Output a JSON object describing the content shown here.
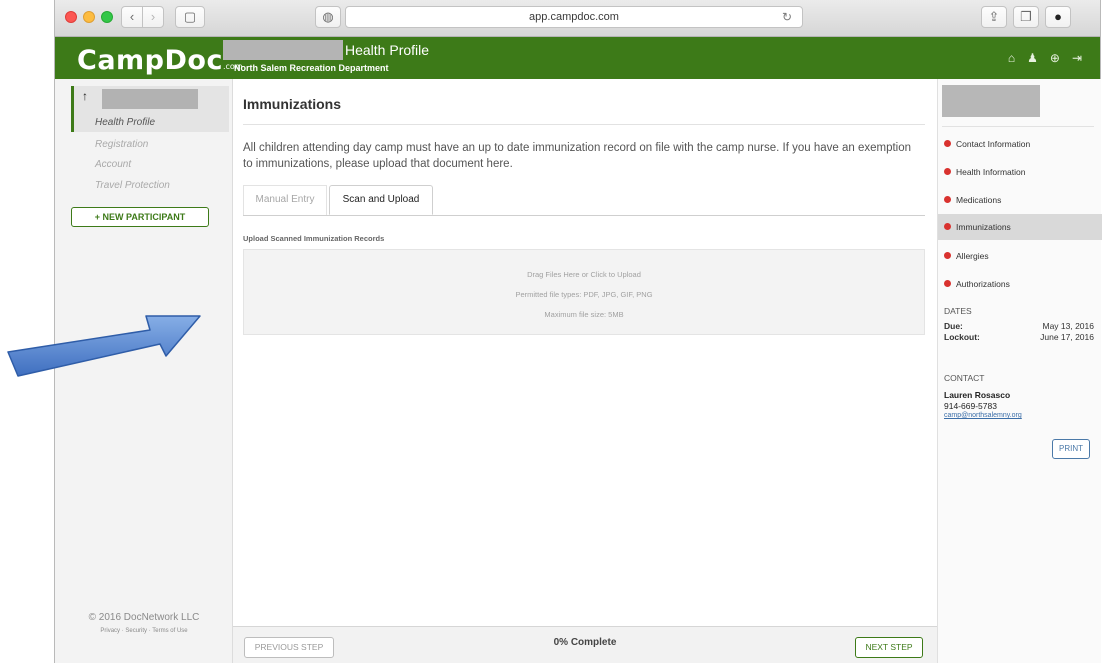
{
  "browser": {
    "back_glyph": "‹",
    "forward_glyph": "›",
    "sidebar_glyph": "▢",
    "shield_glyph": "◍",
    "url": "app.campdoc.com",
    "reload_glyph": "↻",
    "share_glyph": "⇪",
    "tabs_glyph": "❐",
    "extension_glyph": "●"
  },
  "header": {
    "logo_main": "CampDoc",
    "logo_suffix": ".com",
    "title": "Health Profile",
    "subtitle": "North Salem Recreation Department",
    "icons": [
      "home-icon",
      "user-icon",
      "help-icon",
      "logout-icon"
    ],
    "icon_glyphs": [
      "⌂",
      "♟",
      "⊕",
      "⇥"
    ],
    "accent_color": "#3d7a18"
  },
  "leftnav": {
    "up_glyph": "↑",
    "items": [
      {
        "label": "Health Profile",
        "active": true
      },
      {
        "label": "Registration",
        "active": false
      },
      {
        "label": "Account",
        "active": false
      },
      {
        "label": "Travel Protection",
        "active": false
      }
    ],
    "new_participant_label": "+ NEW PARTICIPANT",
    "copyright": "© 2016 DocNetwork LLC",
    "legal": "Privacy · Security · Terms of Use"
  },
  "main": {
    "title": "Immunizations",
    "intro": "All children attending day camp must have an up to date immunization record on file with the camp nurse. If you have an exemption to immunizations, please upload that document here.",
    "tabs": [
      {
        "label": "Manual Entry",
        "active": false
      },
      {
        "label": "Scan and Upload",
        "active": true
      }
    ],
    "upload_label": "Upload Scanned Immunization Records",
    "dropzone": {
      "line1": "Drag Files Here or Click to Upload",
      "line2": "Permitted file types: PDF, JPG, GIF, PNG",
      "line3": "Maximum file size: 5MB"
    }
  },
  "footer": {
    "prev_label": "PREVIOUS STEP",
    "progress": "0% Complete",
    "next_label": "NEXT STEP"
  },
  "rightnav": {
    "sections": [
      {
        "label": "Contact Information",
        "active": false
      },
      {
        "label": "Health Information",
        "active": false
      },
      {
        "label": "Medications",
        "active": false
      },
      {
        "label": "Immunizations",
        "active": true
      },
      {
        "label": "Allergies",
        "active": false
      },
      {
        "label": "Authorizations",
        "active": false
      }
    ],
    "status_color": "#d9322f",
    "dates_heading": "DATES",
    "due_label": "Due:",
    "due_value": "May 13, 2016",
    "lockout_label": "Lockout:",
    "lockout_value": "June 17, 2016",
    "contact_heading": "CONTACT",
    "contact_name": "Lauren Rosasco",
    "contact_phone": "914-669-5783",
    "contact_email": "camp@northsalemny.org",
    "print_label": "PRINT"
  }
}
